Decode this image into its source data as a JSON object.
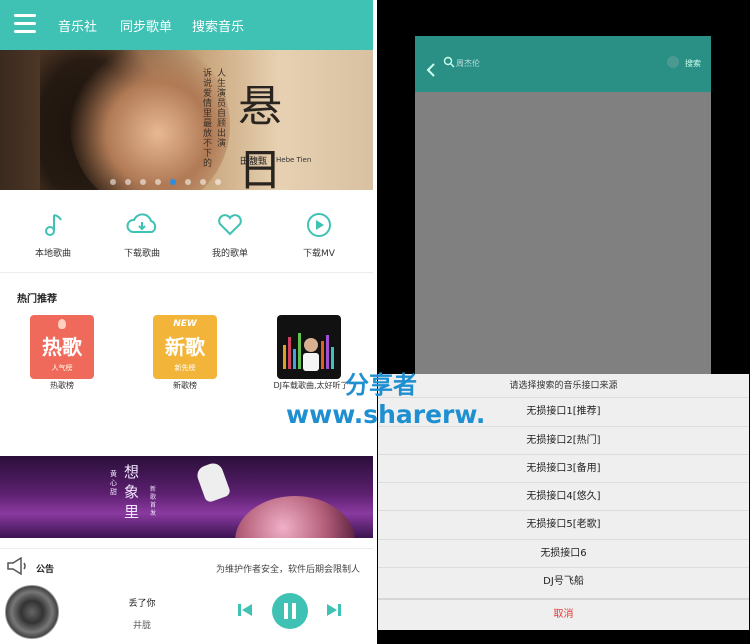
{
  "left_app": {
    "tabs": [
      "音乐社",
      "同步歌单",
      "搜索音乐"
    ],
    "banner": {
      "big_chars": "悬 日",
      "artist_cn": "田馥甄",
      "artist_en": "Hebe Tien",
      "lyric_lines": [
        "人生演员自顾出演",
        "诉说爱情里最放不下的"
      ],
      "dots_total": 8,
      "dot_active": 5
    },
    "shortcuts": [
      {
        "icon": "music-note-icon",
        "label": "本地歌曲"
      },
      {
        "icon": "cloud-download-icon",
        "label": "下载歌曲"
      },
      {
        "icon": "heart-icon",
        "label": "我的歌单"
      },
      {
        "icon": "play-circle-icon",
        "label": "下载MV"
      }
    ],
    "hot_section_title": "热门推荐",
    "hot_tiles": [
      {
        "big": "热歌",
        "small": "人气榜",
        "caption": "热歌榜",
        "color": "#f06a5c"
      },
      {
        "big": "新歌",
        "small": "新先榜",
        "badge": "NEW",
        "caption": "新歌榜",
        "color": "#f2b53a"
      },
      {
        "caption": "DJ车载歌曲,太好听了"
      }
    ],
    "space_banner": {
      "title": "想象里",
      "sub1": "黄心甜",
      "sub2": "新歌首发"
    },
    "notice": {
      "label": "公告",
      "text": "为维护作者安全，软件后期会限制人"
    },
    "player": {
      "song": "丢了你",
      "artist": "井胧"
    },
    "accent": "#3fc1b4"
  },
  "right_app": {
    "search_placeholder": "周杰伦",
    "search_button": "搜索",
    "sheet_title": "请选择搜索的音乐接口来源",
    "options": [
      "无损接口1[推荐]",
      "无损接口2[热门]",
      "无损接口3[备用]",
      "无损接口4[悠久]",
      "无损接口5[老歌]",
      "无损接口6",
      "DJ号飞船"
    ],
    "cancel": "取消",
    "cancel_color": "#e53935"
  },
  "watermark": {
    "line1": "分享者",
    "line2": "www.sharerw."
  }
}
